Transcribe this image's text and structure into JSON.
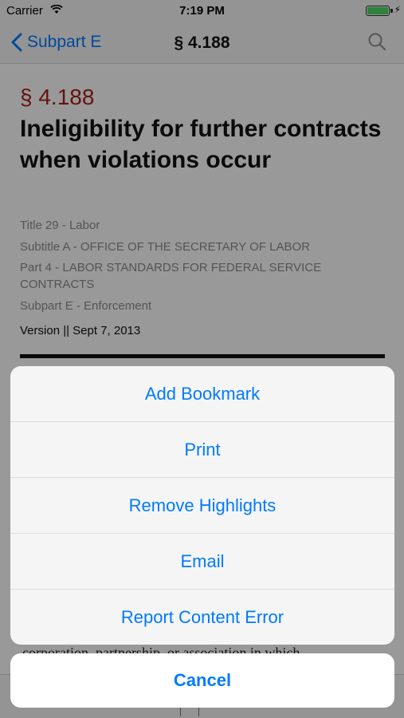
{
  "status_bar": {
    "carrier": "Carrier",
    "time": "7:19 PM",
    "battery_level": 1.0
  },
  "nav": {
    "back_label": "Subpart E",
    "title": "§ 4.188"
  },
  "document": {
    "section_number": "§ 4.188",
    "heading": "Ineligibility for further contracts when violations occur",
    "meta": {
      "title": "Title 29 - Labor",
      "subtitle": "Subtitle A - OFFICE OF THE SECRETARY OF LABOR",
      "part": "Part 4 - LABOR STANDARDS FOR FEDERAL SERVICE CONTRACTS",
      "subpart": "Subpart E - Enforcement"
    },
    "version": "Version || Sept 7, 2013",
    "body_fragment": "corporation, partnership, or association in which"
  },
  "action_sheet": {
    "items": [
      {
        "label": "Add Bookmark"
      },
      {
        "label": "Print"
      },
      {
        "label": "Remove Highlights"
      },
      {
        "label": "Email"
      },
      {
        "label": "Report Content Error"
      }
    ],
    "cancel_label": "Cancel"
  },
  "colors": {
    "accent": "#007aff",
    "section_number": "#a8211a",
    "battery": "#4cd964"
  },
  "icons": {
    "back": "chevron-left-icon",
    "search": "search-icon",
    "wifi": "wifi-icon",
    "battery": "battery-icon",
    "charging": "bolt-icon"
  }
}
